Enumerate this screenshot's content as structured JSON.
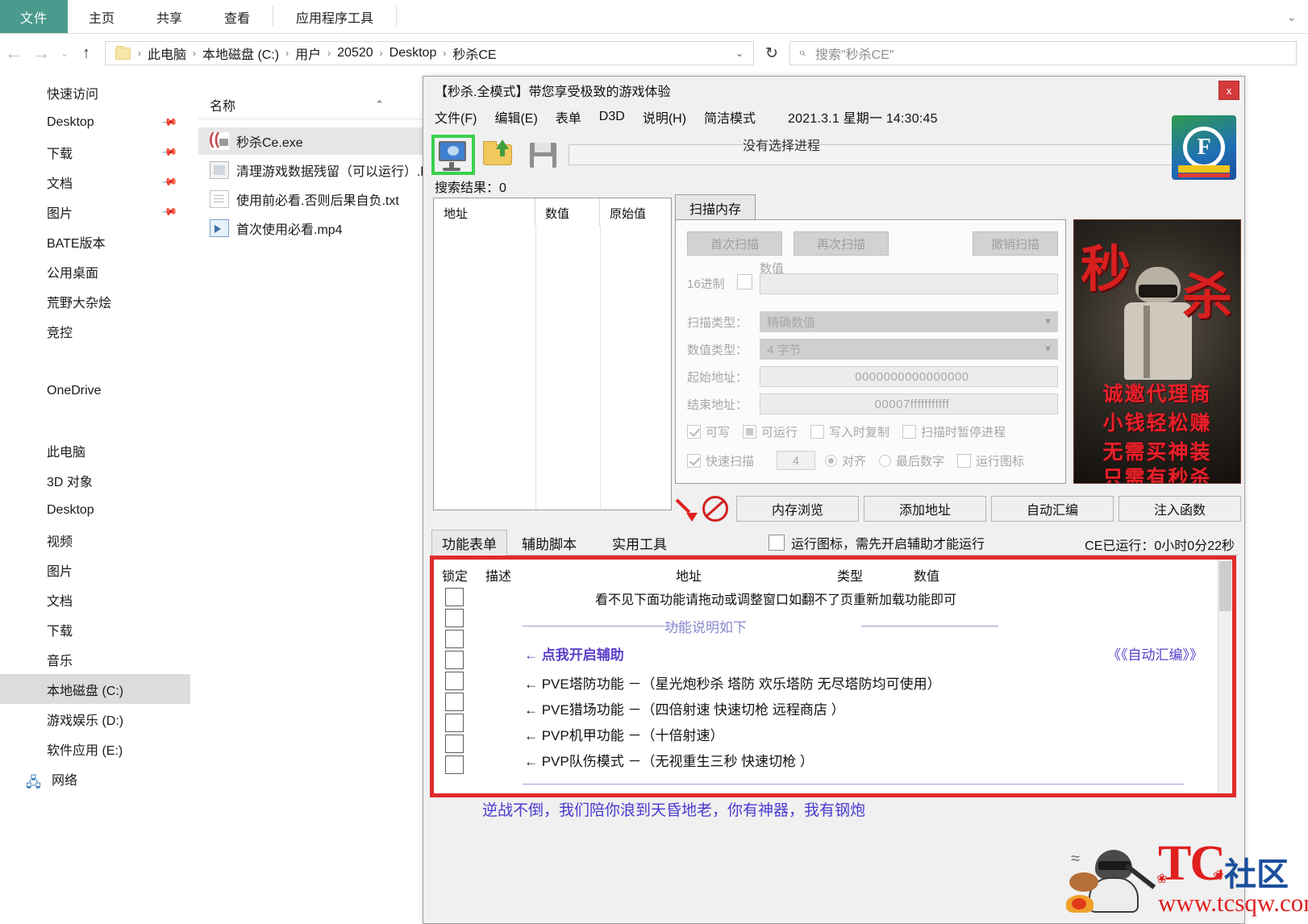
{
  "explorer": {
    "ribbon_tabs": [
      "文件",
      "主页",
      "共享",
      "查看",
      "应用程序工具"
    ],
    "breadcrumb": [
      "此电脑",
      "本地磁盘 (C:)",
      "用户",
      "20520",
      "Desktop",
      "秒杀CE"
    ],
    "search_placeholder": "搜索\"秒杀CE\"",
    "column_header": "名称",
    "files": [
      {
        "name": "秒杀Ce.exe",
        "icon": "ce-app-icon",
        "selected": true
      },
      {
        "name": "清理游戏数据残留（可以运行）.bat",
        "icon": "bat-file-icon",
        "selected": false
      },
      {
        "name": "使用前必看.否则后果自负.txt",
        "icon": "text-file-icon",
        "selected": false
      },
      {
        "name": "首次使用必看.mp4",
        "icon": "video-file-icon",
        "selected": false
      }
    ],
    "nav_items": [
      {
        "label": "快速访问",
        "pin": false,
        "selected": false
      },
      {
        "label": "Desktop",
        "pin": true,
        "selected": false
      },
      {
        "label": "下载",
        "pin": true,
        "selected": false
      },
      {
        "label": "文档",
        "pin": true,
        "selected": false
      },
      {
        "label": "图片",
        "pin": true,
        "selected": false
      },
      {
        "label": "BATE版本",
        "pin": false,
        "selected": false
      },
      {
        "label": "公用桌面",
        "pin": false,
        "selected": false
      },
      {
        "label": "荒野大杂烩",
        "pin": false,
        "selected": false
      },
      {
        "label": "竞控",
        "pin": false,
        "selected": false
      },
      {
        "label": "OneDrive",
        "pin": false,
        "selected": false
      },
      {
        "label": "此电脑",
        "pin": false,
        "selected": false
      },
      {
        "label": "3D 对象",
        "pin": false,
        "selected": false
      },
      {
        "label": "Desktop",
        "pin": false,
        "selected": false
      },
      {
        "label": "视频",
        "pin": false,
        "selected": false
      },
      {
        "label": "图片",
        "pin": false,
        "selected": false
      },
      {
        "label": "文档",
        "pin": false,
        "selected": false
      },
      {
        "label": "下载",
        "pin": false,
        "selected": false
      },
      {
        "label": "音乐",
        "pin": false,
        "selected": false
      },
      {
        "label": "本地磁盘 (C:)",
        "pin": false,
        "selected": true
      },
      {
        "label": "游戏娱乐 (D:)",
        "pin": false,
        "selected": false
      },
      {
        "label": "软件应用 (E:)",
        "pin": false,
        "selected": false
      }
    ],
    "network_label": "网络"
  },
  "ce": {
    "title": "【秒杀.全模式】带您享受极致的游戏体验",
    "close_label": "x",
    "menu": [
      "文件(F)",
      "编辑(E)",
      "表单",
      "D3D",
      "说明(H)",
      "简洁模式"
    ],
    "clock": "2021.3.1 星期一 14:30:45",
    "no_process": "没有选择进程",
    "logo_letter": "F",
    "results_label": "搜索结果：0",
    "result_columns": [
      "地址",
      "数值",
      "原始值"
    ],
    "scan_tab": "扫描内存",
    "scan": {
      "first_scan": "首次扫描",
      "next_scan": "再次扫描",
      "undo_scan": "撤销扫描",
      "hex_label": "16进制",
      "value_label": "数值",
      "value_text": "",
      "scan_type_label": "扫描类型：",
      "scan_type_value": "精确数值",
      "value_type_label": "数值类型：",
      "value_type_value": "4 字节",
      "start_addr_label": "起始地址：",
      "start_addr_value": "0000000000000000",
      "end_addr_label": "结束地址：",
      "end_addr_value": "00007fffffffffff",
      "cb_writable": "可写",
      "cb_executable": "可运行",
      "cb_copyonwrite": "写入时复制",
      "cb_pause": "扫描时暂停进程",
      "cb_fastscan": "快速扫描",
      "fastscan_num": "4",
      "radio_align": "对齐",
      "radio_lastdigit": "最后数字",
      "cb_runicon": "运行图标"
    },
    "action_buttons": [
      "内存浏览",
      "添加地址",
      "自动汇编",
      "注入函数"
    ],
    "ad": {
      "big1": "秒",
      "big2": "杀",
      "lines": [
        "诚邀代理商",
        "小钱轻松赚",
        "无需买神装",
        "只需有秒杀"
      ]
    },
    "lower_tabs": [
      "功能表单",
      "辅助脚本",
      "实用工具"
    ],
    "run_icon_note": "运行图标，需先开启辅助才能运行",
    "runtime": "CE已运行：0小时0分22秒",
    "list_headers": [
      "锁定",
      "描述",
      "地址",
      "类型",
      "数值"
    ],
    "list_rows": [
      {
        "text": "看不见下面功能请拖动或调整窗口如翻不了页重新加载功能即可",
        "style": "note"
      },
      {
        "text": "功能说明如下",
        "style": "divider"
      },
      {
        "text": "←  点我开启辅助",
        "style": "highlight",
        "right": "《《自动汇编》》"
      },
      {
        "text": "←  PVE塔防功能 －（星光炮秒杀 塔防 欢乐塔防 无尽塔防均可使用）",
        "style": "normal"
      },
      {
        "text": "←  PVE猎场功能 －（四倍射速 快速切枪 远程商店 ）",
        "style": "normal"
      },
      {
        "text": "←  PVP机甲功能 －（十倍射速）",
        "style": "normal"
      },
      {
        "text": "←  PVP队伤模式 －（无视重生三秒 快速切枪 ）",
        "style": "normal"
      },
      {
        "text": "",
        "style": "blank"
      },
      {
        "text": "逆战不倒，我们陪你浪到天昏地老，你有神器，我有钢炮",
        "style": "slogan"
      }
    ]
  },
  "watermark": {
    "brand": "TC",
    "brand_cn": "社区",
    "url": "www.tcsqw.com"
  },
  "colors": {
    "file_tab": "#4a9a8e",
    "red_border": "#e02b2b",
    "purple_text": "#5a3ec8",
    "brand_red": "#e01f1f",
    "brand_blue": "#1b4f9c",
    "highlight_green": "#39d14c"
  }
}
